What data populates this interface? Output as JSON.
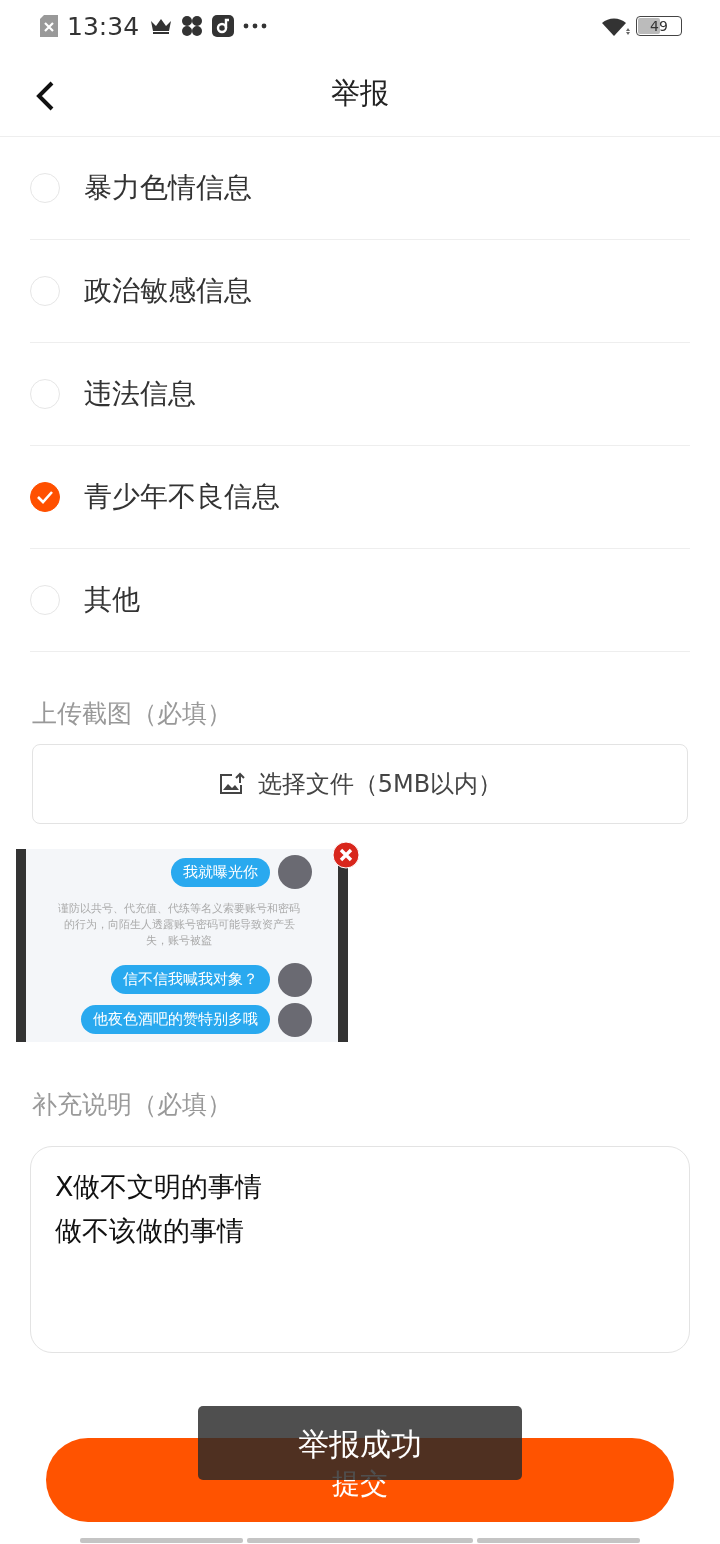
{
  "status_bar": {
    "time": "13:34",
    "battery": "49"
  },
  "header": {
    "title": "举报"
  },
  "reasons": [
    {
      "label": "暴力色情信息",
      "selected": false
    },
    {
      "label": "政治敏感信息",
      "selected": false
    },
    {
      "label": "违法信息",
      "selected": false
    },
    {
      "label": "青少年不良信息",
      "selected": true
    },
    {
      "label": "其他",
      "selected": false
    }
  ],
  "upload": {
    "label": "上传截图（必填）",
    "button": "选择文件（5MB以内）"
  },
  "attachment": {
    "messages": [
      {
        "kind": "bubble",
        "text": "我就曝光你"
      },
      {
        "kind": "notice",
        "text": "谨防以共号、代充值、代练等名义索要账号和密码的行为，向陌生人透露账号密码可能导致资产丢失，账号被盗"
      },
      {
        "kind": "bubble",
        "text": "信不信我喊我对象？"
      },
      {
        "kind": "bubble",
        "text": "他夜色酒吧的赞特别多哦"
      }
    ]
  },
  "description": {
    "label": "补充说明（必填）",
    "lines": [
      "X做不文明的事情",
      "做不该做的事情"
    ]
  },
  "submit": "提交",
  "toast": "举报成功"
}
